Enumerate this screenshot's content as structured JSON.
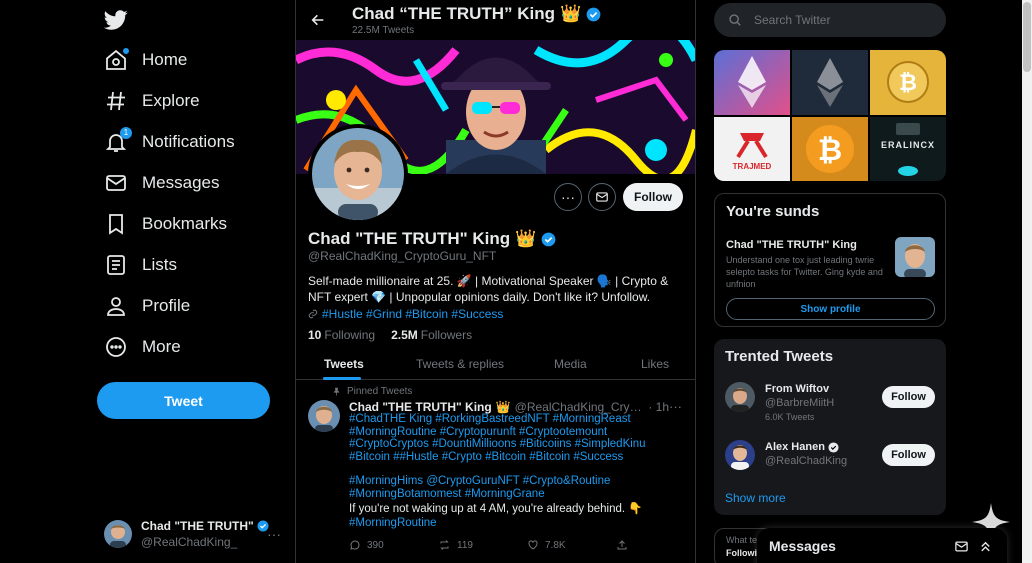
{
  "sidebar": {
    "logo_icon": "twitter-bird-icon",
    "items": [
      {
        "label": "Home",
        "icon": "home-icon"
      },
      {
        "label": "Explore",
        "icon": "hashtag-icon"
      },
      {
        "label": "Notifications",
        "icon": "bell-icon",
        "badge": "1"
      },
      {
        "label": "Messages",
        "icon": "envelope-icon"
      },
      {
        "label": "Bookmarks",
        "icon": "bookmark-icon"
      },
      {
        "label": "Lists",
        "icon": "list-icon"
      },
      {
        "label": "Profile",
        "icon": "person-icon"
      },
      {
        "label": "More",
        "icon": "more-circle-icon"
      }
    ],
    "tweet_button": "Tweet",
    "account": {
      "name": "Chad \"THE TRUTH\"",
      "handle": "@RealChadKing_",
      "more": "···"
    }
  },
  "header": {
    "name": "Chad “THE TRUTH” King",
    "tweet_count": "22.5M Tweets"
  },
  "profile": {
    "name": "Chad \"THE TRUTH\" King",
    "handle": "@RealChadKing_CryptoGuru_NFT",
    "bio": "Self-made millionaire at 25. 🚀 | Motivational Speaker 🗣️ | Crypto & NFT expert 💎 | Unpopular opinions daily. Don't like it? Unfollow.",
    "links": "#Hustle #Grind #Bitcoin #Success",
    "following_count": "10",
    "following_label": "Following",
    "followers_count": "2.5M",
    "followers_label": "Followers",
    "follow_button": "Follow",
    "more_dots": "···"
  },
  "tabs": [
    "Tweets",
    "Tweets & replies",
    "Media",
    "Likes"
  ],
  "pinned_tweet": {
    "pinned_label": "Pinned Tweets",
    "name": "Chad \"THE TRUTH\" King",
    "handle": "@RealChadKing_CryptoGuru_NFT",
    "time": "· 1h",
    "more": "···",
    "hashtags_1": [
      "#ChadTHE King #RorkingBastreedNFT #MorningReast",
      "#MorningRoutine #Cryptopurunft #Cryptootemount",
      "#CryptoCryptos #DountiMillioons #Biticoiins #SimpledKinu",
      "#Bitcoin ##Hustle #Crypto #Bitcoin #Bitcoin #Success"
    ],
    "hashtags_2": [
      "#MorningHims @CryptoGuruNFT #Crypto&Routine",
      "#MorningBotamomest #MorningGrane"
    ],
    "text": "If you're not waking up at 4 AM, you're already behind. 👇",
    "hashtags_3": "#MorningRoutine",
    "replies": "390",
    "retweets": "119",
    "likes": "7.8K"
  },
  "right": {
    "search_placeholder": "Search Twitter",
    "media_tiles": [
      "TRAJMED",
      "ERALINCX"
    ],
    "suggest": {
      "title": "You're sunds",
      "name": "Chad \"THE TRUTH\" King",
      "desc": "Understand one tox just leading twrie selepto tasks for Twitter. Ging kyde and unfnion",
      "button": "Show profile"
    },
    "trends": {
      "title": "Trented Tweets",
      "items": [
        {
          "name": "From Wiftov",
          "handle": "@BarbreMiitH",
          "sub": "6.0K Tweets",
          "button": "Follow",
          "verified": false
        },
        {
          "name": "Alex Hanen",
          "handle": "@RealChadKing",
          "sub": "",
          "button": "Follow",
          "verified": true
        }
      ],
      "show_more": "Show more"
    },
    "whats": {
      "text": "What te",
      "sub": "Followi"
    }
  },
  "messages_drawer": {
    "title": "Messages"
  },
  "colors": {
    "accent": "#1d9bf0",
    "background": "#000000",
    "border": "#2f3336",
    "muted": "#71767b"
  }
}
